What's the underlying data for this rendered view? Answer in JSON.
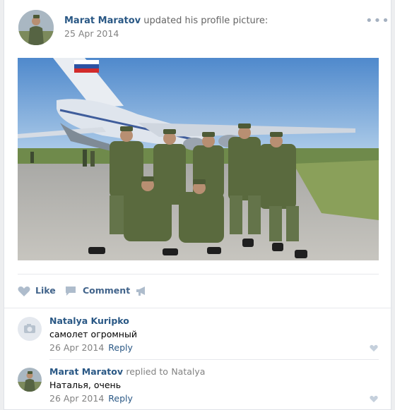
{
  "post": {
    "author": "Marat Maratov",
    "action": "updated his profile picture:",
    "date": "25 Apr 2014",
    "more_icon": "more-horizontal-icon"
  },
  "actions": {
    "like_label": "Like",
    "comment_label": "Comment"
  },
  "comments": [
    {
      "author": "Natalya Kuripko",
      "text": "самолет огромный",
      "date": "26 Apr 2014",
      "reply_label": "Reply"
    },
    {
      "author": "Marat Maratov",
      "replied": "replied to",
      "reply_to": "Natalya",
      "text": "Наталья, очень",
      "date": "26 Apr 2014",
      "reply_label": "Reply"
    }
  ],
  "colors": {
    "link": "#2a5885",
    "action": "#42648b",
    "meta": "#828282",
    "icon": "#aebccc",
    "sky": "#6fa3d8"
  }
}
